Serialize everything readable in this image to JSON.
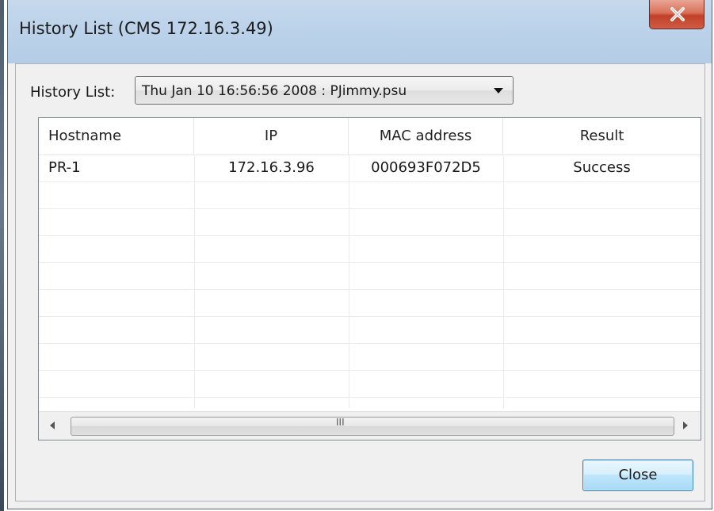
{
  "window": {
    "title": "History List (CMS  172.16.3.49)"
  },
  "history": {
    "label": "History List:",
    "selected": "Thu Jan 10 16:56:56 2008 : PJimmy.psu"
  },
  "table": {
    "columns": [
      "Hostname",
      "IP",
      "MAC address",
      "Result"
    ],
    "rows": [
      {
        "hostname": "PR-1",
        "ip": "172.16.3.96",
        "mac": "000693F072D5",
        "result": "Success"
      }
    ]
  },
  "scrollbar": {
    "grip": "III"
  },
  "buttons": {
    "close_label": "Close"
  },
  "icons": {
    "window_close": "close-x-icon",
    "dropdown": "chevron-down-icon",
    "scroll_left": "arrow-left-icon",
    "scroll_right": "arrow-right-icon"
  },
  "colors": {
    "titlebar": "#bcd3ea",
    "close_button": "#c2402a",
    "default_button_border": "#3c7fb1"
  }
}
